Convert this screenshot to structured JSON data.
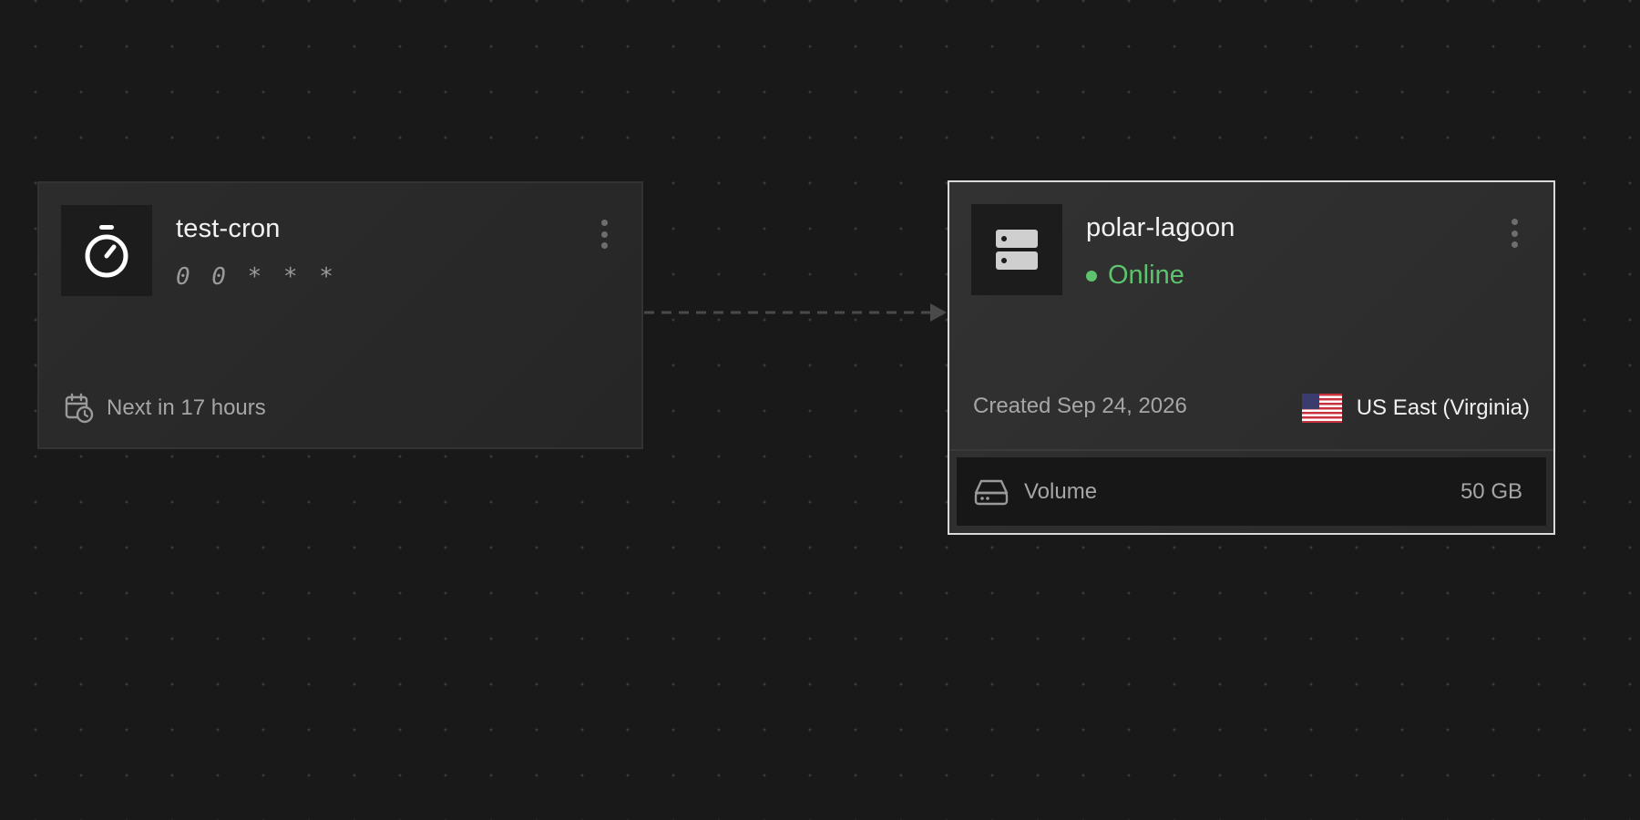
{
  "cron": {
    "name": "test-cron",
    "schedule": "0 0 * * *",
    "next_run": "Next in 17 hours",
    "icon": "stopwatch-icon"
  },
  "service": {
    "name": "polar-lagoon",
    "status": "Online",
    "created": "Created Sep 24, 2026",
    "region": "US East (Virginia)",
    "icon": "server-icon",
    "volume": {
      "label": "Volume",
      "size": "50 GB"
    }
  },
  "colors": {
    "background": "#191919",
    "card": "#2a2a2a",
    "online": "#5dc36d",
    "selected_border": "#d9d9d9"
  }
}
